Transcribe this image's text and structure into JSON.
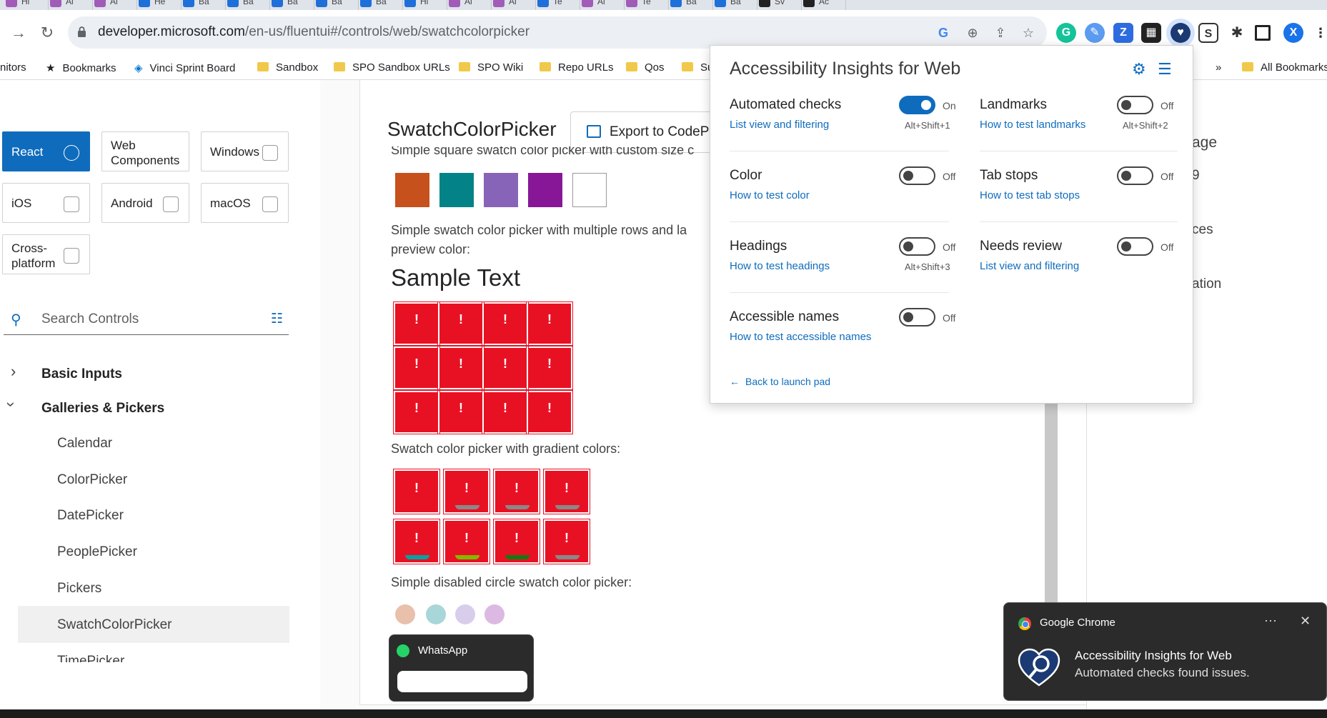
{
  "browser": {
    "tabs": [
      {
        "label": "Hi",
        "color": "#a05cb6"
      },
      {
        "label": "Ai",
        "color": "#a05cb6"
      },
      {
        "label": "Ai",
        "color": "#a05cb6"
      },
      {
        "label": "He",
        "color": "#1e6fd9"
      },
      {
        "label": "Ba",
        "color": "#1e6fd9"
      },
      {
        "label": "Ba",
        "color": "#1e6fd9"
      },
      {
        "label": "Ba",
        "color": "#1e6fd9"
      },
      {
        "label": "Ba",
        "color": "#1e6fd9"
      },
      {
        "label": "Ba",
        "color": "#1e6fd9"
      },
      {
        "label": "Hi",
        "color": "#1e6fd9"
      },
      {
        "label": "Ai",
        "color": "#a05cb6"
      },
      {
        "label": "Ai",
        "color": "#a05cb6"
      },
      {
        "label": "Te",
        "color": "#1e6fd9"
      },
      {
        "label": "Ai",
        "color": "#a05cb6"
      },
      {
        "label": "Te",
        "color": "#a05cb6"
      },
      {
        "label": "Ba",
        "color": "#1e6fd9"
      },
      {
        "label": "Ba",
        "color": "#1e6fd9"
      },
      {
        "label": "Sv",
        "color": "#222222"
      },
      {
        "label": "Ac",
        "color": "#222222"
      }
    ],
    "url_domain": "developer.microsoft.com",
    "url_path": "/en-us/fluentui#/controls/web/swatchcolorpicker",
    "bookmarks": [
      {
        "label": "nitors",
        "type": "text"
      },
      {
        "label": "Bookmarks",
        "type": "star"
      },
      {
        "label": "Vinci Sprint Board",
        "type": "link"
      },
      {
        "label": "Sandbox",
        "type": "folder"
      },
      {
        "label": "SPO Sandbox URLs",
        "type": "folder"
      },
      {
        "label": "SPO Wiki",
        "type": "folder"
      },
      {
        "label": "Repo URLs",
        "type": "folder"
      },
      {
        "label": "Qos",
        "type": "folder"
      },
      {
        "label": "Su",
        "type": "folder"
      }
    ],
    "bookmarks_overflow": "»",
    "all_bookmarks": "All Bookmarks",
    "profile_initial": "X"
  },
  "sidebar": {
    "platforms": [
      {
        "label": "React",
        "active": true
      },
      {
        "label": "Web Components",
        "active": false
      },
      {
        "label": "Windows",
        "active": false
      },
      {
        "label": "iOS",
        "active": false
      },
      {
        "label": "Android",
        "active": false
      },
      {
        "label": "macOS",
        "active": false
      },
      {
        "label": "Cross-platform",
        "active": false
      }
    ],
    "search_placeholder": "Search Controls",
    "categories": [
      {
        "label": "Basic Inputs",
        "expanded": false
      },
      {
        "label": "Galleries & Pickers",
        "expanded": true
      }
    ],
    "items": [
      "Calendar",
      "ColorPicker",
      "DatePicker",
      "PeoplePicker",
      "Pickers",
      "SwatchColorPicker",
      "TimePicker"
    ],
    "selected_item": "SwatchColorPicker"
  },
  "main": {
    "title": "SwatchColorPicker",
    "export_label": "Export to CodePen",
    "cut_text": "Simple square swatch color picker with custom size c",
    "swatches": [
      "#c7511d",
      "#038387",
      "#8764b8",
      "#881798",
      "#ffffff"
    ],
    "desc2": "Simple swatch color picker with multiple rows and la",
    "desc2_cont": "preview color:",
    "sample_text": "Sample Text",
    "error_mark": "!",
    "desc3": "Swatch color picker with gradient colors:",
    "gradient_arcs": [
      "#e81123",
      "#888888",
      "#888888",
      "#888888",
      "#00a3a3",
      "#7fba00",
      "#107c10",
      "#888888"
    ],
    "desc4": "Simple disabled circle swatch color picker:",
    "disabled_circles": [
      "#e8c0ab",
      "#a9d6d8",
      "#d9cdec",
      "#dcb9e2"
    ]
  },
  "right_panel": {
    "fragments": [
      "age",
      "9",
      "ces",
      "ation"
    ]
  },
  "whatsapp": {
    "title": "WhatsApp"
  },
  "ai_popup": {
    "header": "Accessibility Insights for Web",
    "items": [
      {
        "title": "Automated checks",
        "link": "List view and filtering",
        "shortcut": "Alt+Shift+1",
        "state": "On"
      },
      {
        "title": "Landmarks",
        "link": "How to test landmarks",
        "shortcut": "Alt+Shift+2",
        "state": "Off"
      },
      {
        "title": "Color",
        "link": "How to test color",
        "shortcut": "",
        "state": "Off"
      },
      {
        "title": "Tab stops",
        "link": "How to test tab stops",
        "shortcut": "",
        "state": "Off"
      },
      {
        "title": "Headings",
        "link": "How to test headings",
        "shortcut": "Alt+Shift+3",
        "state": "Off"
      },
      {
        "title": "Needs review",
        "link": "List view and filtering",
        "shortcut": "",
        "state": "Off"
      },
      {
        "title": "Accessible names",
        "link": "How to test accessible names",
        "shortcut": "",
        "state": "Off"
      }
    ],
    "back_label": "Back to launch pad"
  },
  "toast": {
    "app": "Google Chrome",
    "more": "···",
    "close": "✕",
    "title": "Accessibility Insights for Web",
    "body": "Automated checks found issues."
  },
  "colors": {
    "accent": "#0f6cbd",
    "error": "#e81123",
    "toast_bg": "#2b2b2b"
  }
}
